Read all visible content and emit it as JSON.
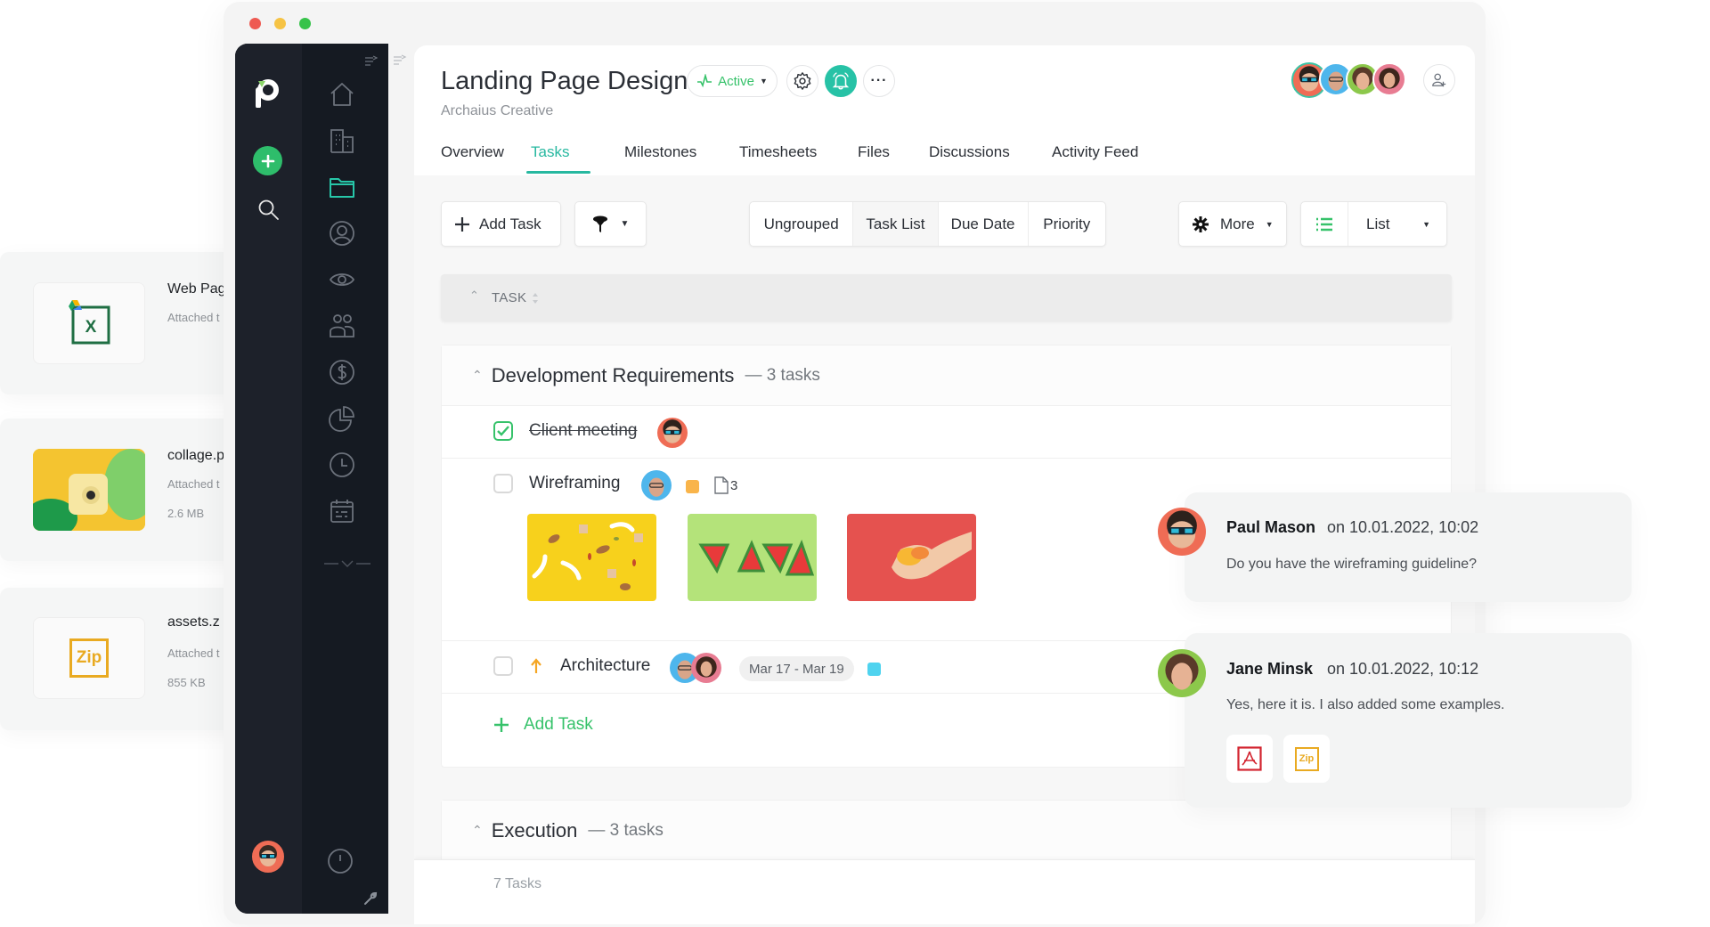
{
  "window": {
    "traffic_lights": {
      "close": "#ee5a52",
      "minimize": "#f6c344",
      "maximize": "#36c34a"
    }
  },
  "colors": {
    "accent": "#27b8a0",
    "green": "#36c26a",
    "sidebar": "#1b1f27",
    "orange_tag": "#f9b44a",
    "blue_tag": "#4fd3ef",
    "pdf_red": "#d3242f",
    "zip_gold": "#e9aa21"
  },
  "attachments_panel": [
    {
      "name": "Web Pag",
      "subtitle": "Attached t",
      "icon": "google-drive-excel-icon",
      "size": ""
    },
    {
      "name": "collage.p",
      "subtitle": "Attached t",
      "icon": "image-thumbnail",
      "size": "2.6 MB"
    },
    {
      "name": "assets.z",
      "subtitle": "Attached t",
      "icon": "zip-icon",
      "size": "855 KB",
      "zip_label": "Zip"
    }
  ],
  "sidebar": {
    "logo": "p",
    "primary": [
      {
        "icon": "plus-icon"
      },
      {
        "icon": "search-icon"
      }
    ],
    "nav": [
      {
        "icon": "home-icon",
        "active": false
      },
      {
        "icon": "buildings-icon",
        "active": false
      },
      {
        "icon": "folder-icon",
        "active": true
      },
      {
        "icon": "user-circle-icon",
        "active": false
      },
      {
        "icon": "eye-icon",
        "active": false
      },
      {
        "icon": "users-icon",
        "active": false
      },
      {
        "icon": "dollar-icon",
        "active": false
      },
      {
        "icon": "pie-chart-icon",
        "active": false
      },
      {
        "icon": "clock-icon",
        "active": false
      },
      {
        "icon": "calendar-icon",
        "active": false
      }
    ]
  },
  "header": {
    "title": "Landing Page Design",
    "subtitle": "Archaius Creative",
    "status": "Active",
    "members": [
      "Paul Mason",
      "Member 2",
      "Jane Minsk",
      "Member 4"
    ]
  },
  "tabs": [
    {
      "label": "Overview",
      "active": false
    },
    {
      "label": "Tasks",
      "active": true
    },
    {
      "label": "Milestones",
      "active": false
    },
    {
      "label": "Timesheets",
      "active": false
    },
    {
      "label": "Files",
      "active": false
    },
    {
      "label": "Discussions",
      "active": false
    },
    {
      "label": "Activity Feed",
      "active": false
    }
  ],
  "toolbar": {
    "add_task": "Add Task",
    "grouping": [
      {
        "label": "Ungrouped",
        "selected": false
      },
      {
        "label": "Task List",
        "selected": true
      },
      {
        "label": "Due Date",
        "selected": false
      },
      {
        "label": "Priority",
        "selected": false
      }
    ],
    "more": "More",
    "view": "List"
  },
  "table": {
    "column": "TASK"
  },
  "groups": [
    {
      "title": "Development Requirements",
      "count": "— 3 tasks",
      "tasks": [
        {
          "name": "Client meeting",
          "done": true
        },
        {
          "name": "Wireframing",
          "done": false,
          "tag_color": "#f9b44a",
          "file_count": "3"
        },
        {
          "name": "Architecture",
          "done": false,
          "priority": "high",
          "dates": "Mar 17 - Mar 19",
          "tag_color": "#4fd3ef"
        }
      ],
      "add_task": "Add Task"
    },
    {
      "title": "Execution",
      "count": "— 3 tasks"
    }
  ],
  "footer": {
    "total": "7 Tasks"
  },
  "comments": [
    {
      "author": "Paul Mason",
      "date": "on 10.01.2022, 10:02",
      "text": "Do you have the wireframing guideline?"
    },
    {
      "author": "Jane Minsk",
      "date": "on 10.01.2022, 10:12",
      "text": "Yes, here it is. I also added some examples.",
      "attachments": [
        {
          "type": "pdf"
        },
        {
          "type": "zip",
          "label": "Zip"
        }
      ]
    }
  ]
}
